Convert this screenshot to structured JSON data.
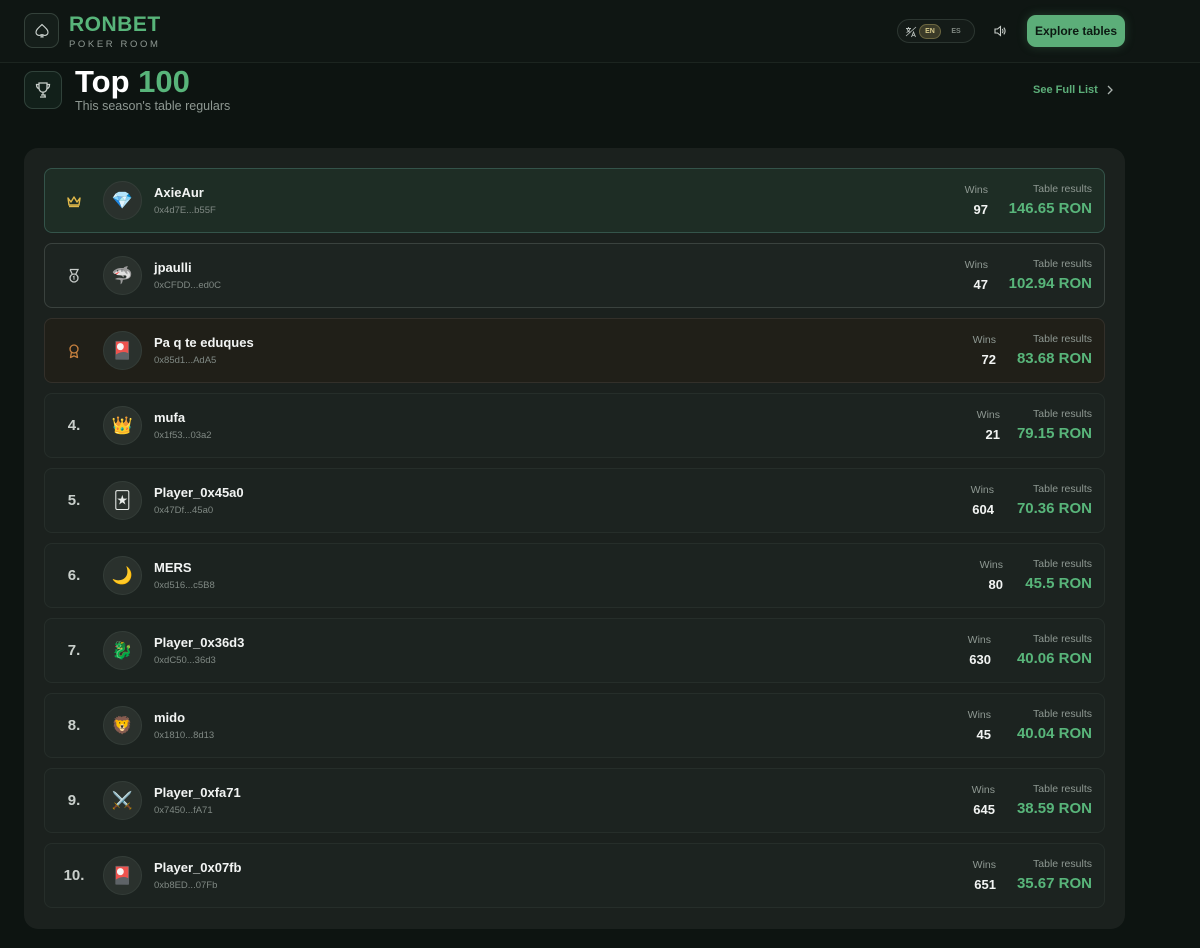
{
  "header": {
    "brand_title": "RONBET",
    "brand_subtitle": "POKER ROOM",
    "lang_en": "EN",
    "lang_es": "ES",
    "explore_label": "Explore tables"
  },
  "title_section": {
    "title_main": "Top ",
    "title_accent": "100",
    "subtitle": "This season's table regulars",
    "see_full_label": "See Full List"
  },
  "labels": {
    "wins": "Wins",
    "table_results": "Table results"
  },
  "players": [
    {
      "rank": "",
      "medal": "crown-icon",
      "name": "AxieAur",
      "address": "0x4d7E...b55F",
      "wins": "97",
      "result": "146.65 RON",
      "avatar": "💎"
    },
    {
      "rank": "",
      "medal": "silver-medal-icon",
      "name": "jpaulli",
      "address": "0xCFDD...ed0C",
      "wins": "47",
      "result": "102.94 RON",
      "avatar": "🦈"
    },
    {
      "rank": "",
      "medal": "bronze-medal-icon",
      "name": "Pa q te eduques",
      "address": "0x85d1...AdA5",
      "wins": "72",
      "result": "83.68 RON",
      "avatar": "🎴"
    },
    {
      "rank": "4.",
      "name": "mufa",
      "address": "0x1f53...03a2",
      "wins": "21",
      "result": "79.15 RON",
      "avatar": "👑"
    },
    {
      "rank": "5.",
      "name": "Player_0x45a0",
      "address": "0x47Df...45a0",
      "wins": "604",
      "result": "70.36 RON",
      "avatar": "🃏"
    },
    {
      "rank": "6.",
      "name": "MERS",
      "address": "0xd516...c5B8",
      "wins": "80",
      "result": "45.5 RON",
      "avatar": "🌙"
    },
    {
      "rank": "7.",
      "name": "Player_0x36d3",
      "address": "0xdC50...36d3",
      "wins": "630",
      "result": "40.06 RON",
      "avatar": "🐉"
    },
    {
      "rank": "8.",
      "name": "mido",
      "address": "0x1810...8d13",
      "wins": "45",
      "result": "40.04 RON",
      "avatar": "🦁"
    },
    {
      "rank": "9.",
      "name": "Player_0xfa71",
      "address": "0x7450...fA71",
      "wins": "645",
      "result": "38.59 RON",
      "avatar": "⚔️"
    },
    {
      "rank": "10.",
      "name": "Player_0x07fb",
      "address": "0xb8ED...07Fb",
      "wins": "651",
      "result": "35.67 RON",
      "avatar": "🎴"
    }
  ],
  "colors": {
    "accent": "#58b57a",
    "background": "#0d1411",
    "gold": "#e0b84a",
    "silver": "#c8ccca",
    "bronze": "#c9823f"
  }
}
